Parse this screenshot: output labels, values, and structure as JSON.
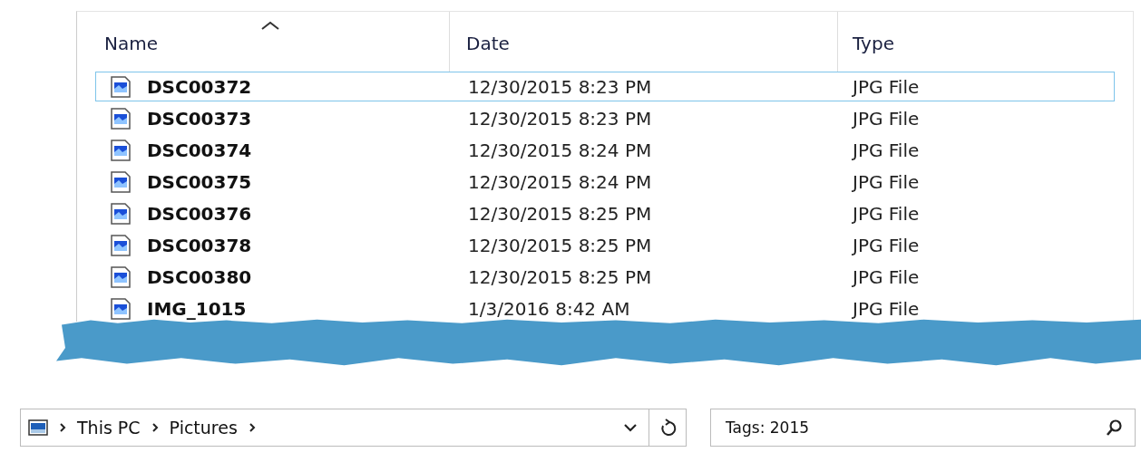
{
  "file_list": {
    "columns": [
      {
        "label": "Name",
        "sorted": true
      },
      {
        "label": "Date",
        "sorted": false
      },
      {
        "label": "Type",
        "sorted": false
      }
    ],
    "rows": [
      {
        "name": "DSC00372",
        "date": "12/30/2015 8:23 PM",
        "type": "JPG File",
        "selected": true
      },
      {
        "name": "DSC00373",
        "date": "12/30/2015 8:23 PM",
        "type": "JPG File",
        "selected": false
      },
      {
        "name": "DSC00374",
        "date": "12/30/2015 8:24 PM",
        "type": "JPG File",
        "selected": false
      },
      {
        "name": "DSC00375",
        "date": "12/30/2015 8:24 PM",
        "type": "JPG File",
        "selected": false
      },
      {
        "name": "DSC00376",
        "date": "12/30/2015 8:25 PM",
        "type": "JPG File",
        "selected": false
      },
      {
        "name": "DSC00378",
        "date": "12/30/2015 8:25 PM",
        "type": "JPG File",
        "selected": false
      },
      {
        "name": "DSC00380",
        "date": "12/30/2015 8:25 PM",
        "type": "JPG File",
        "selected": false
      },
      {
        "name": "IMG_1015",
        "date": "1/3/2016 8:42 AM",
        "type": "JPG File",
        "selected": false
      }
    ]
  },
  "address_bar": {
    "path": [
      "This PC",
      "Pictures"
    ]
  },
  "search": {
    "value": "Tags: 2015"
  }
}
